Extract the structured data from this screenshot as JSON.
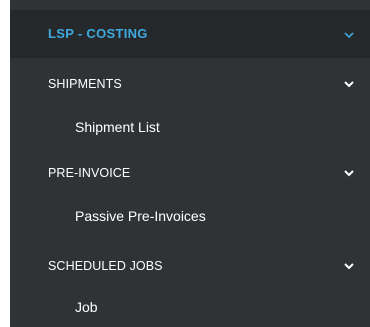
{
  "module": {
    "label": "LSP - COSTING",
    "accent_color": "#3fa9e0",
    "icon": "chevron-down-icon"
  },
  "sections": [
    {
      "label": "SHIPMENTS",
      "icon": "chevron-down-icon",
      "items": [
        {
          "label": "Shipment List"
        }
      ]
    },
    {
      "label": "PRE-INVOICE",
      "icon": "chevron-down-icon",
      "items": [
        {
          "label": "Passive Pre-Invoices"
        }
      ]
    },
    {
      "label": "SCHEDULED JOBS",
      "icon": "chevron-down-icon",
      "items": [
        {
          "label": "Job"
        }
      ]
    }
  ]
}
